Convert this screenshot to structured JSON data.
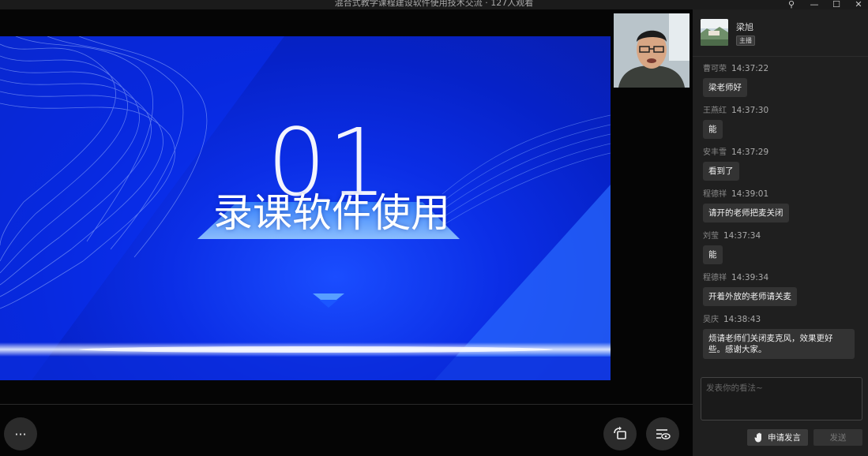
{
  "window": {
    "title": "混合式教学课程建设软件使用技术交流 · 127人观看",
    "controls": {
      "pin": "⚲",
      "minimize": "—",
      "maximize": "☐",
      "close": "✕"
    }
  },
  "slide": {
    "number": "01",
    "title": "录课软件使用"
  },
  "toolbar": {
    "more_label": "···"
  },
  "host": {
    "name": "梁旭",
    "badge": "主播"
  },
  "messages": [
    {
      "name": "曹可荣",
      "time": "14:37:22",
      "text": "梁老师好"
    },
    {
      "name": "王燕红",
      "time": "14:37:30",
      "text": "能"
    },
    {
      "name": "安丰雪",
      "time": "14:37:29",
      "text": "看到了"
    },
    {
      "name": "程德祥",
      "time": "14:39:01",
      "text": "请开的老师把麦关闭"
    },
    {
      "name": "刘莹",
      "time": "14:37:34",
      "text": "能"
    },
    {
      "name": "程德祥",
      "time": "14:39:34",
      "text": "开着外放的老师请关麦"
    },
    {
      "name": "吴庆",
      "time": "14:38:43",
      "text": "烦请老师们关闭麦克风，效果更好些。感谢大家。"
    }
  ],
  "composer": {
    "placeholder": "发表你的看法~",
    "raise_hand_label": "申请发言",
    "send_label": "发送"
  },
  "colors": {
    "slide_blue": "#0b2ee6",
    "sidebar_bg": "#1f1f1f",
    "bubble_bg": "#333333"
  }
}
